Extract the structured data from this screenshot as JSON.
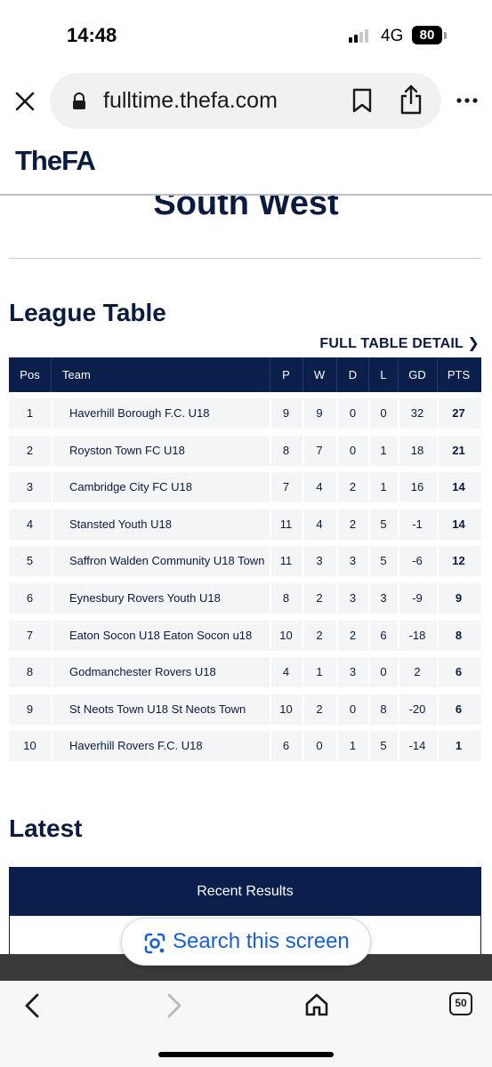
{
  "status_bar": {
    "time": "14:48",
    "network": "4G",
    "battery": "80"
  },
  "browser": {
    "url": "fulltime.thefa.com"
  },
  "header": {
    "logo": "TheFA"
  },
  "region_title": "South West",
  "league_table": {
    "title": "League Table",
    "full_detail_link": "FULL TABLE DETAIL",
    "columns": [
      "Pos",
      "Team",
      "P",
      "W",
      "D",
      "L",
      "GD",
      "PTS"
    ],
    "rows": [
      [
        "1",
        "Haverhill Borough F.C. U18",
        "9",
        "9",
        "0",
        "0",
        "32",
        "27"
      ],
      [
        "2",
        "Royston Town FC U18",
        "8",
        "7",
        "0",
        "1",
        "18",
        "21"
      ],
      [
        "3",
        "Cambridge City FC U18",
        "7",
        "4",
        "2",
        "1",
        "16",
        "14"
      ],
      [
        "4",
        "Stansted Youth U18",
        "11",
        "4",
        "2",
        "5",
        "-1",
        "14"
      ],
      [
        "5",
        "Saffron Walden Community U18 Town",
        "11",
        "3",
        "3",
        "5",
        "-6",
        "12"
      ],
      [
        "6",
        "Eynesbury Rovers Youth U18",
        "8",
        "2",
        "3",
        "3",
        "-9",
        "9"
      ],
      [
        "7",
        "Eaton Socon U18 Eaton Socon u18",
        "10",
        "2",
        "2",
        "6",
        "-18",
        "8"
      ],
      [
        "8",
        "Godmanchester Rovers U18",
        "4",
        "1",
        "3",
        "0",
        "2",
        "6"
      ],
      [
        "9",
        "St Neots Town U18 St Neots Town",
        "10",
        "2",
        "0",
        "8",
        "-20",
        "6"
      ],
      [
        "10",
        "Haverhill Rovers F.C. U18",
        "6",
        "0",
        "1",
        "5",
        "-14",
        "1"
      ]
    ]
  },
  "latest": {
    "title": "Latest",
    "recent_results_label": "Recent Results"
  },
  "lens": {
    "label": "Search this screen"
  },
  "toolbar": {
    "tabs_count": "50"
  }
}
